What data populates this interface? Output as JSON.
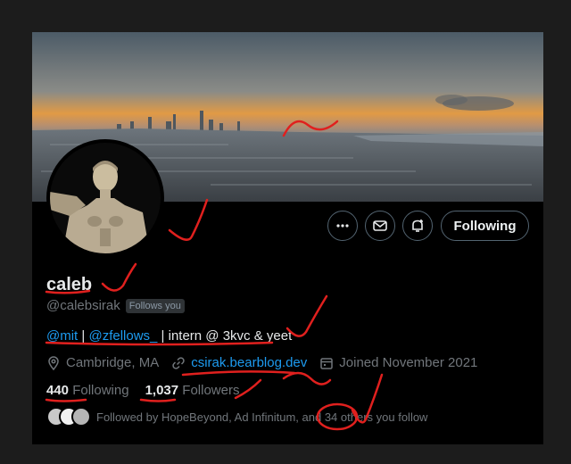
{
  "profile": {
    "name": "caleb",
    "handle": "@calebsirak",
    "follows_you_badge": "Follows you",
    "bio": {
      "mention1": "@mit",
      "sep1": " | ",
      "mention2": "@zfellows_",
      "rest": " | intern @ 3kvc & yeet"
    },
    "location": "Cambridge, MA",
    "website": "csirak.bearblog.dev",
    "joined": "Joined November 2021",
    "following_count": "440",
    "following_label": "Following",
    "followers_count": "1,037",
    "followers_label": "Followers",
    "followed_by": "Followed by HopeBeyond, Ad Infinitum, and 34 others you follow"
  },
  "actions": {
    "more_label": "more-icon",
    "message_label": "mail-icon",
    "notify_label": "bell-plus-icon",
    "following_button": "Following"
  },
  "colors": {
    "background": "#000000",
    "link": "#1d9bf0",
    "muted": "#71767b",
    "annotation": "#e0201e"
  }
}
